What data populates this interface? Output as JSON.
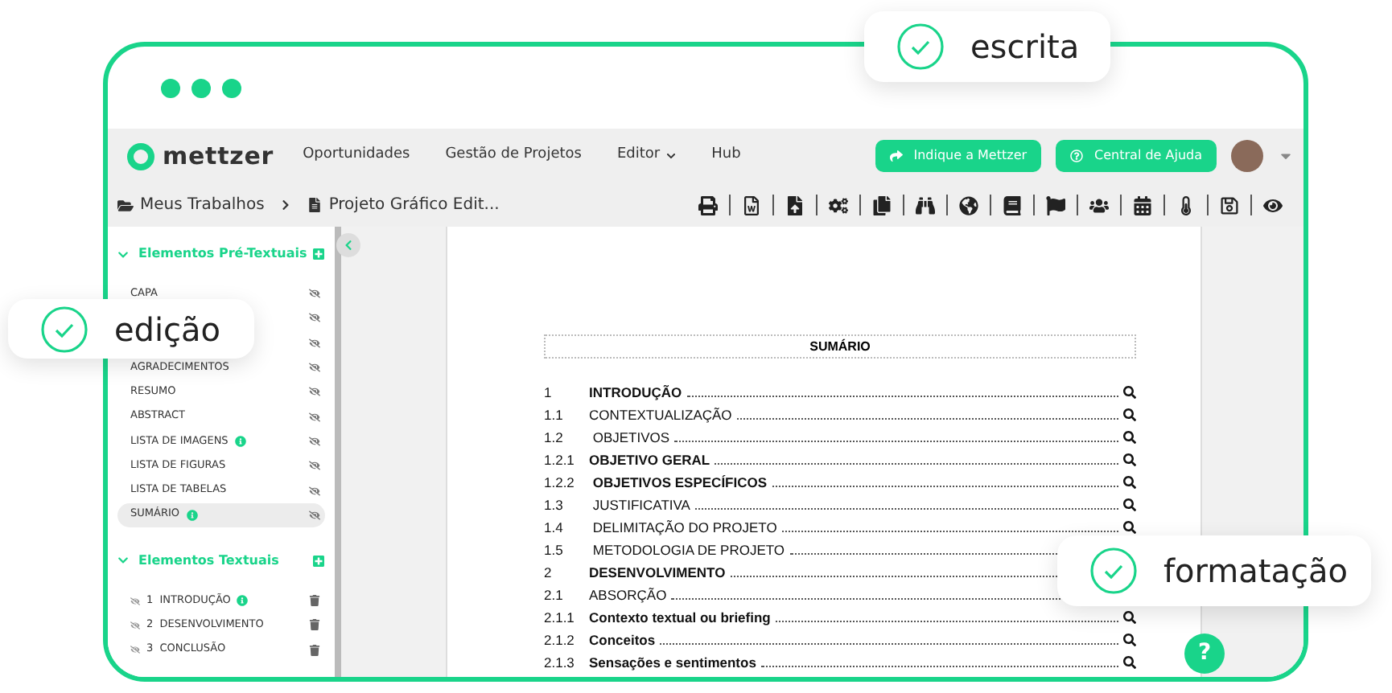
{
  "badges": [
    {
      "kind": "top",
      "label": "escrita"
    },
    {
      "kind": "left",
      "label": "edição"
    },
    {
      "kind": "right",
      "label": "formatação"
    }
  ],
  "nav": {
    "links": [
      {
        "label": "Oportunidades",
        "dropdown": false
      },
      {
        "label": "Gestão de Projetos",
        "dropdown": false
      },
      {
        "label": "Editor",
        "dropdown": true
      },
      {
        "label": "Hub",
        "dropdown": false
      }
    ],
    "logo": "mettzer",
    "buttons": [
      {
        "kind": "share",
        "label": "Indique a Mettzer"
      },
      {
        "kind": "help",
        "label": "Central de Ajuda"
      }
    ]
  },
  "breadcrumb": [
    "Meus Trabalhos",
    "Projeto Gráfico Edit..."
  ],
  "sidebar": {
    "sections": [
      {
        "title": "Elementos Pré-Textuais",
        "kind": "pre",
        "items": [
          {
            "label": "CAPA",
            "info": false,
            "selected": false
          },
          {
            "info": false,
            "selected": false
          },
          {
            "info": false,
            "selected": false
          },
          {
            "label": "AGRADECIMENTOS",
            "info": false,
            "selected": false
          },
          {
            "label": "RESUMO",
            "info": false,
            "selected": false
          },
          {
            "label": "ABSTRACT",
            "info": false,
            "selected": false
          },
          {
            "label": "LISTA DE IMAGENS",
            "info": true,
            "selected": false
          },
          {
            "label": "LISTA DE FIGURAS",
            "info": false,
            "selected": false
          },
          {
            "label": "LISTA DE TABELAS",
            "info": false,
            "selected": false
          },
          {
            "label": "SUMÁRIO",
            "info": true,
            "selected": true
          }
        ]
      },
      {
        "title": "Elementos Textuais",
        "kind": "text",
        "items": [
          {
            "label": "1  INTRODUÇÃO",
            "info": true,
            "selected": false
          },
          {
            "label": "2  DESENVOLVIMENTO",
            "info": false,
            "selected": false
          },
          {
            "label": "3  CONCLUSÃO",
            "info": false,
            "selected": false
          }
        ]
      }
    ]
  },
  "document": {
    "title": "SUMÁRIO",
    "toc": [
      {
        "number": "1",
        "title": "INTRODUÇÃO",
        "bold": true,
        "search": true
      },
      {
        "number": "1.1",
        "title": "CONTEXTUALIZAÇÃO",
        "bold": false,
        "search": true
      },
      {
        "number": "1.2",
        "title": " OBJETIVOS",
        "bold": false,
        "search": true
      },
      {
        "number": "1.2.1",
        "title": "OBJETIVO GERAL",
        "bold": true,
        "search": true
      },
      {
        "number": "1.2.2",
        "title": " OBJETIVOS ESPECÍFICOS",
        "bold": true,
        "search": true
      },
      {
        "number": "1.3",
        "title": " JUSTIFICATIVA",
        "bold": false,
        "search": true
      },
      {
        "number": "1.4",
        "title": " DELIMITAÇÃO DO PROJETO",
        "bold": false,
        "search": true
      },
      {
        "number": "1.5",
        "title": " METODOLOGIA DE PROJETO",
        "bold": false,
        "search": false
      },
      {
        "number": "2",
        "title": "DESENVOLVIMENTO",
        "bold": true,
        "search": false
      },
      {
        "number": "2.1",
        "title": "ABSORÇÃO",
        "bold": false,
        "search": false
      },
      {
        "number": "2.1.1",
        "title": "Contexto textual ou briefing",
        "bold": true,
        "search": true
      },
      {
        "number": "2.1.2",
        "title": "Conceitos",
        "bold": true,
        "search": true
      },
      {
        "number": "2.1.3",
        "title": "Sensações e sentimentos",
        "bold": true,
        "search": true
      }
    ]
  },
  "help": {
    "label": "?"
  }
}
